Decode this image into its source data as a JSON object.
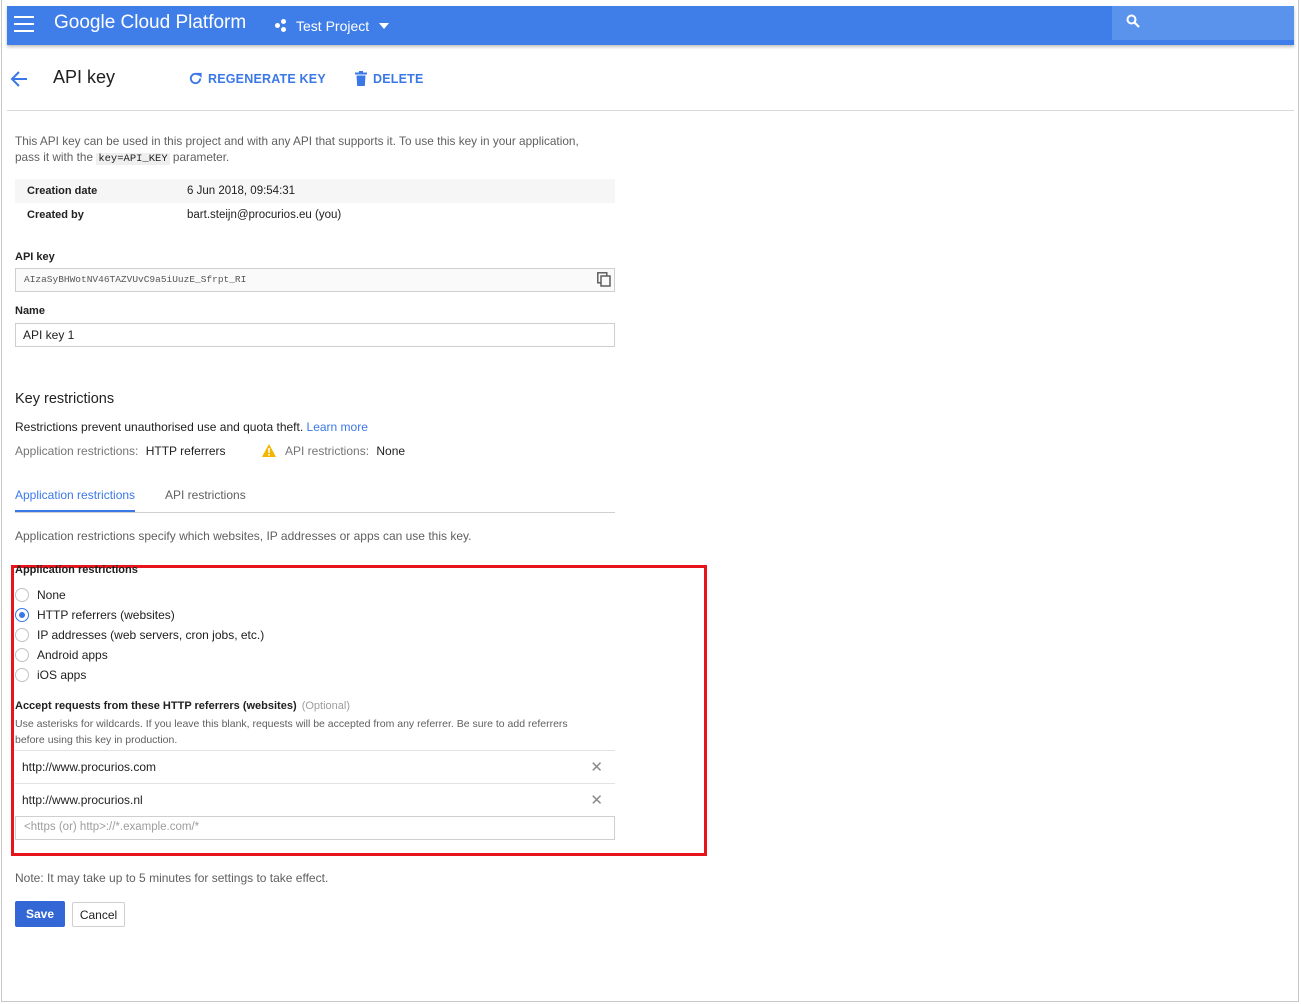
{
  "header": {
    "brand": "Google Cloud Platform",
    "project": "Test Project"
  },
  "page": {
    "title": "API key",
    "regenerate_label": "REGENERATE KEY",
    "delete_label": "DELETE"
  },
  "intro": {
    "line1": "This API key can be used in this project and with any API that supports it. To use this key in your application,",
    "line2_prefix": "pass it with the ",
    "code": "key=API_KEY",
    "line2_suffix": " parameter."
  },
  "meta": {
    "creation_label": "Creation date",
    "creation_value": "6 Jun 2018, 09:54:31",
    "created_by_label": "Created by",
    "created_by_value": "bart.steijn@procurios.eu (you)"
  },
  "api_key": {
    "label": "API key",
    "value": "AIzaSyBHWotNV46TAZVUvC9a5iUuzE_Sfrpt_RI"
  },
  "name": {
    "label": "Name",
    "value": "API key 1"
  },
  "restrictions": {
    "title": "Key restrictions",
    "desc": "Restrictions prevent unauthorised use and quota theft. ",
    "learn_more": "Learn more",
    "app_label": "Application restrictions:",
    "app_value": "HTTP referrers",
    "api_label": "API restrictions:",
    "api_value": "None",
    "warning_color": "#f4b400"
  },
  "tabs": {
    "app": "Application restrictions",
    "api": "API restrictions"
  },
  "app_restrictions": {
    "desc": "Application restrictions specify which websites, IP addresses or apps can use this key.",
    "heading": "Application restrictions",
    "options": [
      "None",
      "HTTP referrers (websites)",
      "IP addresses (web servers, cron jobs, etc.)",
      "Android apps",
      "iOS apps"
    ],
    "selected": "HTTP referrers (websites)"
  },
  "referrers": {
    "heading": "Accept requests from these HTTP referrers (websites)",
    "optional": "(Optional)",
    "help1": "Use asterisks for wildcards. If you leave this blank, requests will be accepted from any referrer. Be sure to add referrers",
    "help2": "before using this key in production.",
    "items": [
      "http://www.procurios.com",
      "http://www.procurios.nl"
    ],
    "remove_symbol": "✕",
    "placeholder": "<https (or) http>://*.example.com/*"
  },
  "note": "Note: It may take up to 5 minutes for settings to take effect.",
  "actions": {
    "save": "Save",
    "cancel": "Cancel"
  },
  "colors": {
    "topbar": "#3f7ee8",
    "accent": "#3b78e7",
    "save_button": "#3367d6",
    "highlight_box": "#e8141c"
  }
}
